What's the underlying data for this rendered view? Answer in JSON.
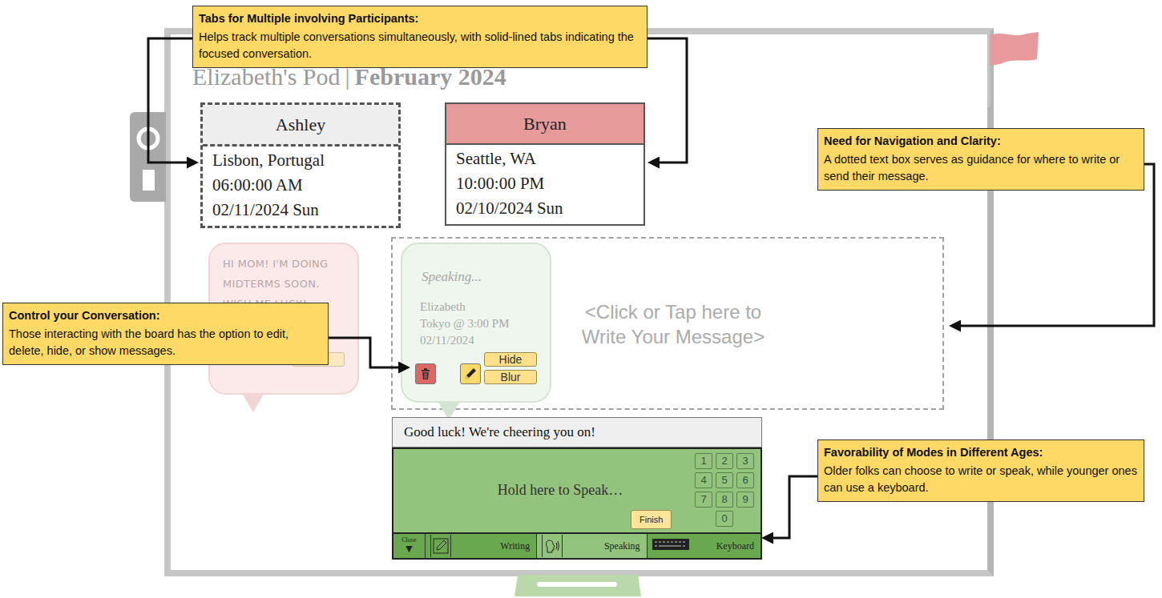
{
  "board": {
    "title": "Elizabeth's Pod",
    "separator": "|",
    "month": "February 2024"
  },
  "tabs": [
    {
      "name": "Ashley",
      "location": "Lisbon, Portugal",
      "time": "06:00:00 AM",
      "date": "02/11/2024 Sun",
      "selected": false
    },
    {
      "name": "Bryan",
      "location": "Seattle, WA",
      "time": "10:00:00 PM",
      "date": "02/10/2024 Sun",
      "selected": true
    }
  ],
  "messages": [
    {
      "kind": "received",
      "text": "HI MOM! I'M DOING MIDTERMS SOON. WISH ME LUCK!",
      "buttons": [
        "Blur"
      ]
    },
    {
      "kind": "sent",
      "status": "Speaking...",
      "sender": "Elizabeth",
      "place": "Tokyo @ 3:00 PM",
      "date": "02/11/2024",
      "buttons": [
        "Hide",
        "Blur"
      ]
    }
  ],
  "compose": {
    "placeholder": "<Click or Tap here to Write Your Message>"
  },
  "input_panel": {
    "text": "Good luck! We're cheering you on!",
    "prompt": "Hold here to Speak…",
    "keys": [
      "1",
      "2",
      "3",
      "4",
      "5",
      "6",
      "7",
      "8",
      "9",
      "0"
    ],
    "finish": "Finish",
    "close": {
      "label": "Close",
      "icon": "▼"
    },
    "modes": [
      {
        "label": "Writing",
        "kind": "writing",
        "selected": false
      },
      {
        "label": "Speaking",
        "kind": "speaking",
        "selected": true
      },
      {
        "label": "Keyboard",
        "kind": "keyboard",
        "selected": false
      }
    ]
  },
  "annotations": [
    {
      "title": "Tabs for Multiple involving Participants:",
      "text": "Helps track multiple conversations simultaneously, with solid-lined tabs indicating the focused conversation."
    },
    {
      "title": "Need for Navigation and Clarity:",
      "text": "A dotted text box serves as guidance for where to write or send their message."
    },
    {
      "title": "Control your Conversation:",
      "text": "Those interacting with the board has the option to edit, delete, hide, or show messages."
    },
    {
      "title": "Favorability of Modes in Different Ages:",
      "text": "Older folks can choose to write or speak, while younger ones can use a keyboard."
    }
  ]
}
